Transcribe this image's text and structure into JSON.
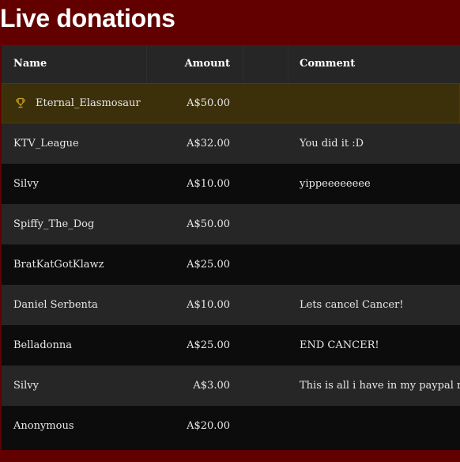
{
  "page": {
    "title": "Live donations"
  },
  "table": {
    "columns": {
      "name": "Name",
      "amount": "Amount",
      "comment": "Comment"
    },
    "rows": [
      {
        "name": "Eternal_Elasmosaur",
        "amount": "A$50.00",
        "comment": ""
      },
      {
        "name": "KTV_League",
        "amount": "A$32.00",
        "comment": "You did it :D"
      },
      {
        "name": "Silvy",
        "amount": "A$10.00",
        "comment": "yippeeeeeeee"
      },
      {
        "name": "Spiffy_The_Dog",
        "amount": "A$50.00",
        "comment": ""
      },
      {
        "name": "BratKatGotKlawz",
        "amount": "A$25.00",
        "comment": ""
      },
      {
        "name": "Daniel Serbenta",
        "amount": "A$10.00",
        "comment": "Lets cancel Cancer!"
      },
      {
        "name": "Belladonna",
        "amount": "A$25.00",
        "comment": "END CANCER!"
      },
      {
        "name": "Silvy",
        "amount": "A$3.00",
        "comment": "This is all i have in my paypal rn,"
      },
      {
        "name": "Anonymous",
        "amount": "A$20.00",
        "comment": ""
      }
    ],
    "top_donor_icon": "trophy-icon"
  },
  "colors": {
    "background": "#620000",
    "header": "#262626",
    "row_dark": "#0c0c0c",
    "row_light": "#262626",
    "top_row": "#3b300a",
    "trophy": "#c8a020"
  }
}
